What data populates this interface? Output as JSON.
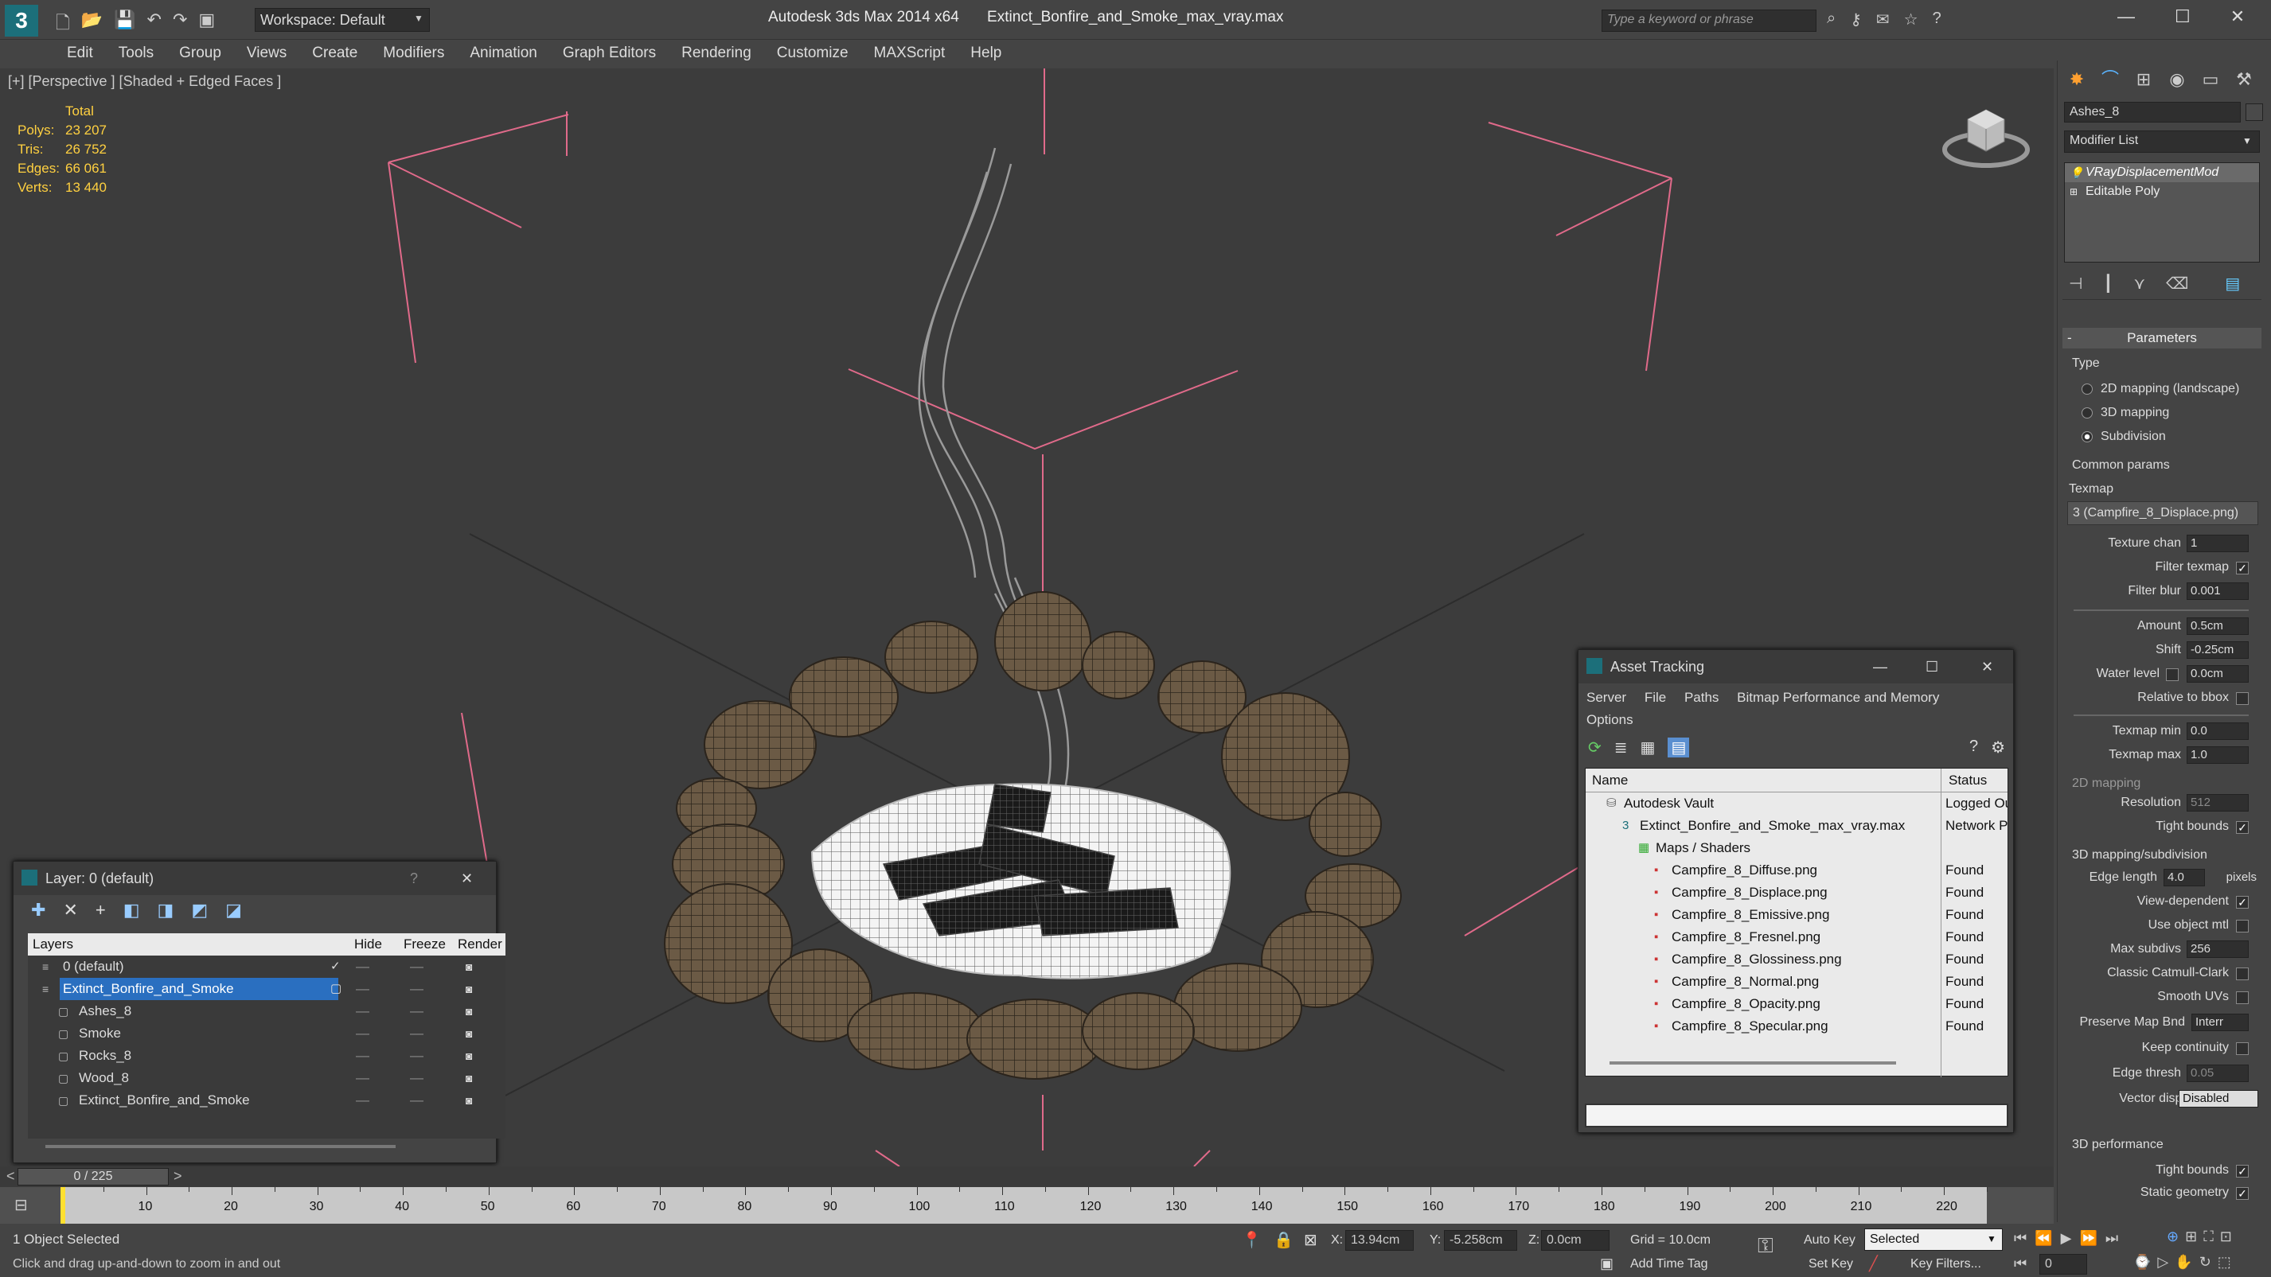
{
  "titlebar": {
    "app_title": "Autodesk 3ds Max  2014 x64",
    "file_title": "Extinct_Bonfire_and_Smoke_max_vray.max",
    "workspace": "Workspace: Default",
    "search_placeholder": "Type a keyword or phrase"
  },
  "menu": [
    "Edit",
    "Tools",
    "Group",
    "Views",
    "Create",
    "Modifiers",
    "Animation",
    "Graph Editors",
    "Rendering",
    "Customize",
    "MAXScript",
    "Help"
  ],
  "viewport": {
    "label": "[+] [Perspective ] [Shaded + Edged Faces ]",
    "stats": {
      "total_label": "Total",
      "rows": [
        {
          "label": "Polys:",
          "value": "23 207"
        },
        {
          "label": "Tris:",
          "value": "26 752"
        },
        {
          "label": "Edges:",
          "value": "66 061"
        },
        {
          "label": "Verts:",
          "value": "13 440"
        }
      ]
    }
  },
  "command_panel": {
    "object_name": "Ashes_8",
    "modifier_list": "Modifier List",
    "stack": [
      "VRayDisplacementMod",
      "Editable Poly"
    ],
    "rollout_title": "Parameters",
    "type_label": "Type",
    "type_options": [
      {
        "label": "2D mapping (landscape)",
        "selected": false
      },
      {
        "label": "3D mapping",
        "selected": false
      },
      {
        "label": "Subdivision",
        "selected": true
      }
    ],
    "common_params": "Common params",
    "texmap_label": "Texmap",
    "texmap_value": "3 (Campfire_8_Displace.png)",
    "texture_chan": {
      "label": "Texture chan",
      "value": "1"
    },
    "filter_texmap": {
      "label": "Filter texmap",
      "checked": "✓"
    },
    "filter_blur": {
      "label": "Filter blur",
      "value": "0.001"
    },
    "amount": {
      "label": "Amount",
      "value": "0.5cm"
    },
    "shift": {
      "label": "Shift",
      "value": "-0.25cm"
    },
    "water_level": {
      "label": "Water level",
      "value": "0.0cm"
    },
    "relative_bbox": {
      "label": "Relative to bbox"
    },
    "texmap_min": {
      "label": "Texmap min",
      "value": "0.0"
    },
    "texmap_max": {
      "label": "Texmap max",
      "value": "1.0"
    },
    "mapping_2d": "2D mapping",
    "resolution": {
      "label": "Resolution",
      "value": "512"
    },
    "tight_bounds_2d": {
      "label": "Tight bounds",
      "checked": "✓"
    },
    "mapping_3d": "3D mapping/subdivision",
    "edge_length": {
      "label": "Edge length",
      "value": "4.0",
      "unit": "pixels"
    },
    "view_dependent": {
      "label": "View-dependent",
      "checked": "✓"
    },
    "use_object_mtl": {
      "label": "Use object mtl"
    },
    "max_subdivs": {
      "label": "Max subdivs",
      "value": "256"
    },
    "classic_catmull": {
      "label": "Classic Catmull-Clark"
    },
    "smooth_uvs": {
      "label": "Smooth UVs"
    },
    "preserve_map_bnd": {
      "label": "Preserve Map Bnd",
      "value": "Interr"
    },
    "keep_continuity": {
      "label": "Keep continuity"
    },
    "edge_thresh": {
      "label": "Edge thresh",
      "value": "0.05"
    },
    "vector_displ": {
      "label": "Vector displ",
      "value": "Disabled"
    },
    "performance_3d": "3D performance",
    "tight_bounds_3d": {
      "label": "Tight bounds",
      "checked": "✓"
    },
    "static_geometry": {
      "label": "Static geometry",
      "checked": "✓"
    }
  },
  "layer_dialog": {
    "title": "Layer: 0 (default)",
    "help": "?",
    "columns": [
      "Layers",
      "Hide",
      "Freeze",
      "Render"
    ],
    "rows": [
      {
        "name": "0 (default)",
        "indent": 0,
        "selected": false
      },
      {
        "name": "Extinct_Bonfire_and_Smoke",
        "indent": 0,
        "selected": true
      },
      {
        "name": "Ashes_8",
        "indent": 1,
        "selected": false
      },
      {
        "name": "Smoke",
        "indent": 1,
        "selected": false
      },
      {
        "name": "Rocks_8",
        "indent": 1,
        "selected": false
      },
      {
        "name": "Wood_8",
        "indent": 1,
        "selected": false
      },
      {
        "name": "Extinct_Bonfire_and_Smoke",
        "indent": 1,
        "selected": false
      }
    ]
  },
  "asset_dialog": {
    "title": "Asset Tracking",
    "menu": [
      "Server",
      "File",
      "Paths",
      "Bitmap Performance and Memory",
      "Options"
    ],
    "columns": [
      "Name",
      "Status"
    ],
    "rows": [
      {
        "name": "Autodesk Vault",
        "status": "Logged Ou",
        "indent": 1
      },
      {
        "name": "Extinct_Bonfire_and_Smoke_max_vray.max",
        "status": "Network P",
        "indent": 2
      },
      {
        "name": "Maps / Shaders",
        "status": "",
        "indent": 3
      },
      {
        "name": "Campfire_8_Diffuse.png",
        "status": "Found",
        "indent": 4
      },
      {
        "name": "Campfire_8_Displace.png",
        "status": "Found",
        "indent": 4
      },
      {
        "name": "Campfire_8_Emissive.png",
        "status": "Found",
        "indent": 4
      },
      {
        "name": "Campfire_8_Fresnel.png",
        "status": "Found",
        "indent": 4
      },
      {
        "name": "Campfire_8_Glossiness.png",
        "status": "Found",
        "indent": 4
      },
      {
        "name": "Campfire_8_Normal.png",
        "status": "Found",
        "indent": 4
      },
      {
        "name": "Campfire_8_Opacity.png",
        "status": "Found",
        "indent": 4
      },
      {
        "name": "Campfire_8_Specular.png",
        "status": "Found",
        "indent": 4
      }
    ]
  },
  "timeline": {
    "frame": "0 / 225",
    "ticks": [
      "10",
      "20",
      "30",
      "40",
      "50",
      "60",
      "70",
      "80",
      "90",
      "100",
      "110",
      "120",
      "130",
      "140",
      "150",
      "160",
      "170",
      "180",
      "190",
      "200",
      "210",
      "220"
    ]
  },
  "status": {
    "selection": "1 Object Selected",
    "hint": "Click and drag up-and-down to zoom in and out",
    "x_label": "X:",
    "x_value": "13.94cm",
    "y_label": "Y:",
    "y_value": "-5.258cm",
    "z_label": "Z:",
    "z_value": "0.0cm",
    "grid": "Grid = 10.0cm",
    "add_time_tag": "Add Time Tag",
    "auto_key": "Auto Key",
    "set_key": "Set Key",
    "selected_dropdown": "Selected",
    "key_filters": "Key Filters...",
    "frame_field": "0"
  }
}
